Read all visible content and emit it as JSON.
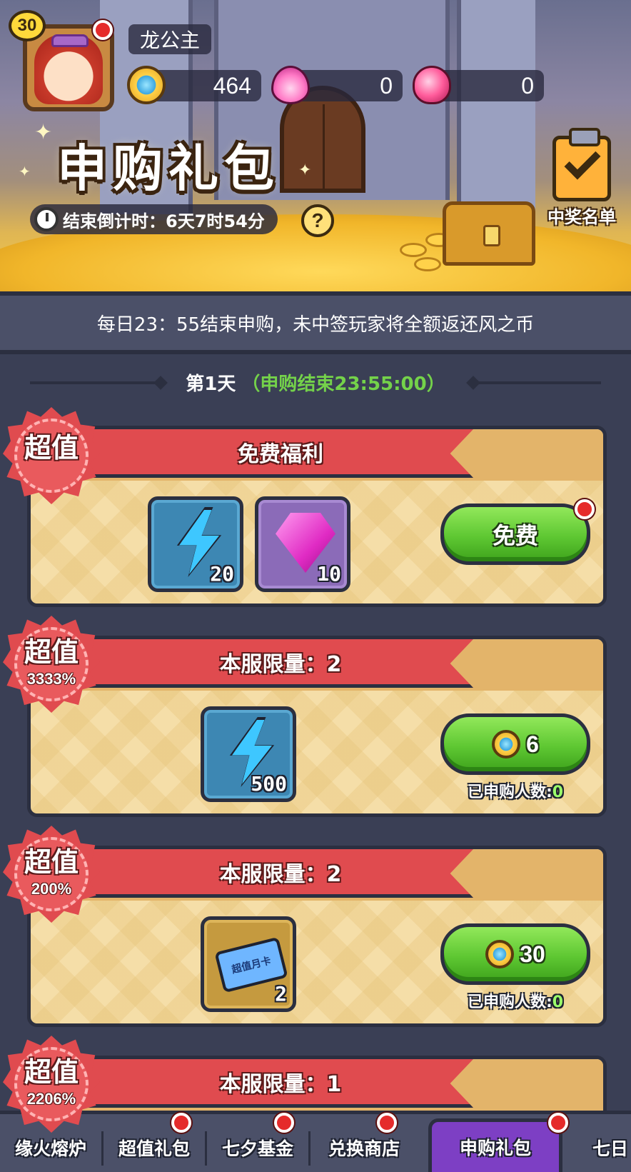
{
  "header": {
    "level": "30",
    "player_name": "龙公主",
    "currencies": [
      {
        "icon": "gem-coin-icon",
        "value": "464"
      },
      {
        "icon": "pink-flame-icon",
        "value": "0"
      },
      {
        "icon": "pink-heart-icon",
        "value": "0"
      }
    ],
    "title": "申购礼包",
    "countdown_label": "结束倒计时：",
    "countdown_value": "6天7时54分",
    "help": "?",
    "winners_label": "中奖名单"
  },
  "notice": "每日23：55结束申购，未中签玩家将全额返还风之币",
  "day": {
    "title": "第1天",
    "subtitle": "（申购结束23:55:00）"
  },
  "packages": [
    {
      "badge": "超值",
      "ribbon": "免费福利",
      "items": [
        {
          "icon": "lightning-icon",
          "count": "20"
        },
        {
          "icon": "pink-gem-icon",
          "count": "10"
        }
      ],
      "button": "免费"
    },
    {
      "badge": "超值",
      "percent": "3333%",
      "ribbon": "本服限量：2",
      "items": [
        {
          "icon": "lightning-icon",
          "count": "500"
        }
      ],
      "price": "6",
      "buyers_label": "已申购人数:",
      "buyers_count": "0"
    },
    {
      "badge": "超值",
      "percent": "200%",
      "ribbon": "本服限量：2",
      "items": [
        {
          "icon": "monthly-card-icon",
          "count": "2",
          "card_text": "超值月卡"
        }
      ],
      "price": "30",
      "buyers_label": "已申购人数:",
      "buyers_count": "0"
    },
    {
      "badge": "超值",
      "percent": "2206%",
      "ribbon": "本服限量：1"
    }
  ],
  "tabs": [
    {
      "label": "缘火熔炉"
    },
    {
      "label": "超值礼包"
    },
    {
      "label": "七夕基金"
    },
    {
      "label": "兑换商店"
    },
    {
      "label": "申购礼包"
    },
    {
      "label": "七日"
    }
  ],
  "colors": {
    "ribbon_red": "#e04b4f",
    "button_green": "#5ec732",
    "active_tab_purple": "#7d3fc4",
    "highlight_green": "#74d24a"
  }
}
